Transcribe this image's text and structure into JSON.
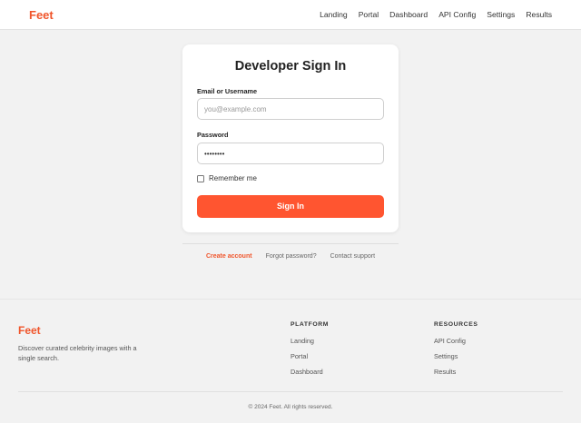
{
  "nav": {
    "brand": "Feet",
    "links": [
      "Landing",
      "Portal",
      "Dashboard",
      "API Config",
      "Settings",
      "Results"
    ]
  },
  "signin": {
    "title": "Developer Sign In",
    "email_label": "Email or Username",
    "email_placeholder": "you@example.com",
    "password_label": "Password",
    "password_value": "••••••••",
    "remember_label": "Remember me",
    "remember_checked": false,
    "submit_label": "Sign In"
  },
  "aux_links": {
    "create_account": "Create account",
    "forgot_password": "Forgot password?",
    "contact_support": "Contact support"
  },
  "footer": {
    "brand": "Feet",
    "tagline": "Discover curated celebrity images with a single search.",
    "platform": {
      "title": "PLATFORM",
      "links": [
        "Landing",
        "Portal",
        "Dashboard"
      ]
    },
    "resources": {
      "title": "RESOURCES",
      "links": [
        "API Config",
        "Settings",
        "Results"
      ]
    },
    "copyright": "© 2024 Feet. All rights reserved."
  },
  "colors": {
    "accent": "#f0552b",
    "button": "#ff5530",
    "background": "#f2f2f2"
  }
}
